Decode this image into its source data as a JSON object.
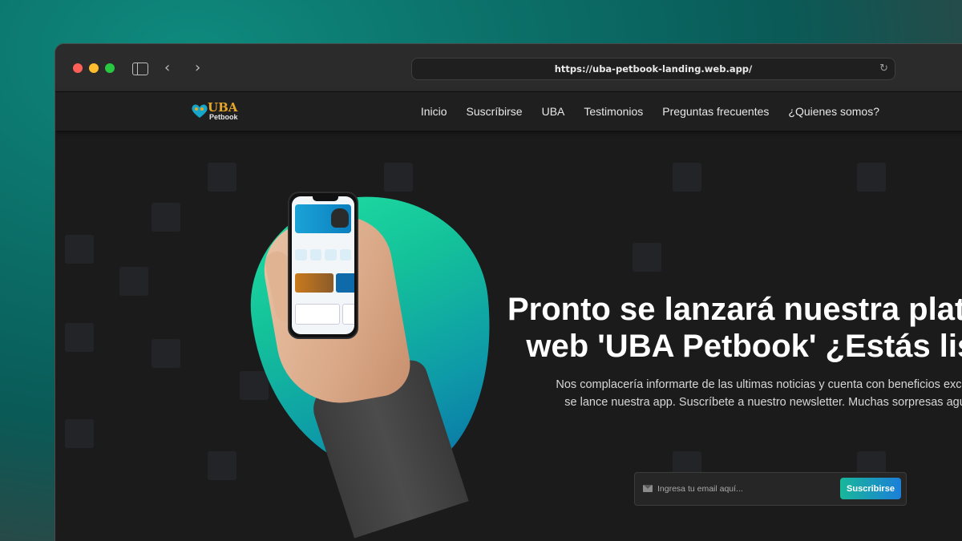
{
  "browser": {
    "url": "https://uba-petbook-landing.web.app/"
  },
  "site": {
    "logo_uba": "UBA",
    "logo_petbook": "Petbook"
  },
  "nav": {
    "items": [
      {
        "label": "Inicio"
      },
      {
        "label": "Suscríbirse"
      },
      {
        "label": "UBA"
      },
      {
        "label": "Testimonios"
      },
      {
        "label": "Preguntas frecuentes"
      },
      {
        "label": "¿Quienes somos?"
      }
    ]
  },
  "hero": {
    "headline_line1": "Pronto se lanzará nuestra platafo",
    "headline_line2": "web 'UBA Petbook' ¿Estás list",
    "sub_line1": "Nos complacería informarte de las ultimas noticias y cuenta con beneficios exclusivo",
    "sub_line2": "se lance nuestra app. Suscríbete a nuestro newsletter. Muchas sorpresas aguard",
    "email_placeholder": "Ingresa tu email aquí...",
    "subscribe_label": "Suscribirse"
  },
  "colors": {
    "accent_start": "#19b79a",
    "accent_end": "#1b7fd8",
    "logo_gold": "#e4a629"
  }
}
